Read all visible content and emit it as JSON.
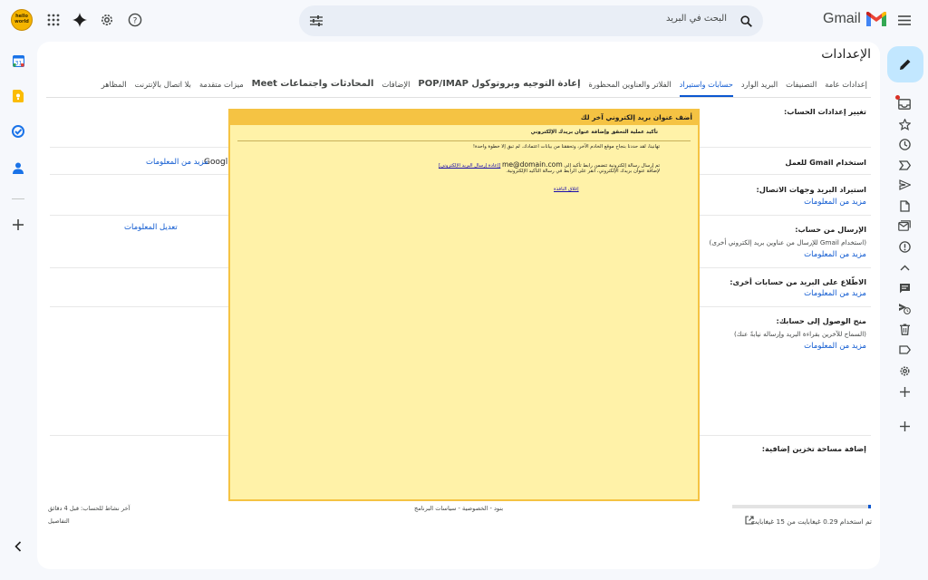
{
  "app": {
    "brand": "Gmail",
    "avatar_text": "hello world"
  },
  "search": {
    "placeholder": "البحث في البريد"
  },
  "settings": {
    "title": "الإعدادات",
    "tabs": [
      {
        "label": "إعدادات عامة",
        "active": false
      },
      {
        "label": "التصنيفات",
        "active": false
      },
      {
        "label": "البريد الوارد",
        "active": false
      },
      {
        "label": "حسابات واستيراد",
        "active": true
      },
      {
        "label": "الفلاتر والعناوين المحظورة",
        "active": false
      },
      {
        "label": "إعادة التوجيه وبروتوكول POP/IMAP",
        "active": false
      },
      {
        "label": "الإضافات",
        "active": false
      },
      {
        "label": "المحادثات واجتماعات Meet",
        "active": false
      },
      {
        "label": "ميزات متقدمة",
        "active": false
      },
      {
        "label": "بلا اتصال بالإنترنت",
        "active": false
      },
      {
        "label": "المظاهر",
        "active": false
      }
    ],
    "sections": {
      "change_account": {
        "label": "تغيير إعدادات الحساب:"
      },
      "gmail_for_work": {
        "label": "استخدام Gmail للعمل",
        "right_text": "Googl",
        "learn_more": "مزيد من المعلومات"
      },
      "import": {
        "label": "استيراد البريد وجهات الاتصال:",
        "learn_more": "مزيد من المعلومات"
      },
      "send_as": {
        "label": "الإرسال من حساب:",
        "sub": "(استخدام Gmail للإرسال من عناوين بريد إلكتروني أخرى)",
        "learn_more": "مزيد من المعلومات",
        "edit_info": "تعديل المعلومات"
      },
      "check_mail": {
        "label": "الاطّلاع على البريد من حسابات أخرى:",
        "learn_more": "مزيد من المعلومات"
      },
      "grant_access": {
        "label": "منح الوصول إلى حسابك:",
        "sub": "(السماح للآخرين بقراءة البريد وإرساله نيابةً عنك)",
        "learn_more": "مزيد من المعلومات"
      },
      "storage": {
        "label": "إضافة مساحة تخزين إضافية:"
      }
    }
  },
  "footer": {
    "storage_text": "تم استخدام 0.29 غيغابايت من 15 غيغابايت",
    "storage_fraction": 0.02,
    "links": "بنود - الخصوصية - سياسات البرنامج",
    "activity": "آخر نشاط للحساب: قبل 4 دقائق",
    "details": "التفاصيل"
  },
  "dialog": {
    "title": "أضف عنوان بريد إلكتروني آخر لك",
    "subtitle": "تأكيد عملية التحقق وإضافة عنوان بريدك الإلكتروني",
    "congrats": "تهانينا، لقد حددنا بنجاح موقع الخادم الآخر، وتحققنا من بيانات اعتمادك. لم تبق إلا خطوة واحدة!",
    "sent_prefix": "تم إرسال رسالة إلكترونية تتضمن رابط تأكيد إلى",
    "email": "me@domain.com",
    "resend_link": "[إعادة إرسال البريد الإلكتروني]",
    "instruction": "لإضافة عنوان بريدك الإلكتروني، انقر على الرابط في رسالة التأكيد الإلكترونية.",
    "close_link": "إغلاق النافذة"
  }
}
